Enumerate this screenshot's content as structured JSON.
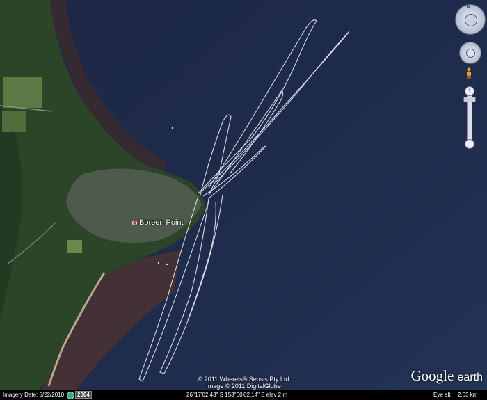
{
  "map": {
    "place_name": "Boreen Point"
  },
  "attribution": {
    "line1": "© 2011 Whereis® Sensis Pty Ltd",
    "line2": "Image © 2011 DigitalGlobe"
  },
  "logo": {
    "google": "Google",
    "earth": "earth"
  },
  "status": {
    "imagery_date": "Imagery Date: 5/22/2010",
    "year": "2004",
    "coordinates": "26°17'02.43\" S 153°00'02.14\" E elev    2 m",
    "eye_alt": "Eye alt",
    "eye_alt_value": "2.63 km"
  },
  "controls": {
    "compass_letter": "N",
    "zoom_in": "+",
    "zoom_out": "−",
    "icons": [
      "compass-icon",
      "look-joystick-icon",
      "pegman-icon",
      "zoom-slider"
    ]
  },
  "colors": {
    "water": "#1f2c4a",
    "land": "#2f4a2a",
    "beach": "#6b4a35",
    "track": "#e8eef5"
  }
}
